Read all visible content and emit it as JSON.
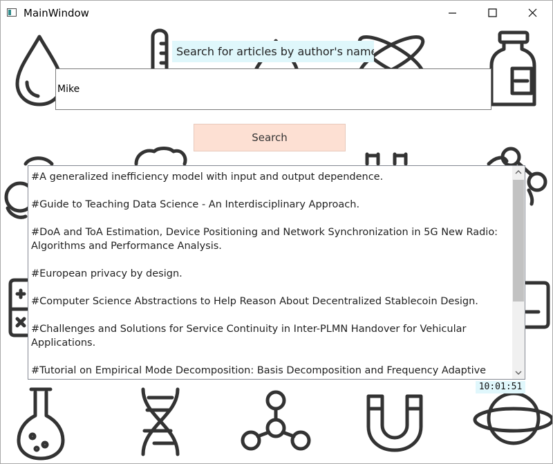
{
  "window": {
    "title": "MainWindow",
    "controls": [
      "minimize-icon",
      "maximize-icon",
      "close-icon"
    ]
  },
  "search": {
    "label": "Search for articles by author's name!",
    "input_value": "Mike",
    "button_label": "Search"
  },
  "results": [
    "#A generalized inefficiency model with input and output dependence.",
    "#Guide to Teaching Data Science - An Interdisciplinary Approach.",
    "#DoA and ToA Estimation, Device Positioning and Network Synchronization in 5G New Radio: Algorithms and Performance Analysis.",
    "#European privacy by design.",
    "#Computer Science Abstractions to Help Reason About Decentralized Stablecoin Design.",
    "#Challenges and Solutions for Service Continuity in Inter-PLMN Handover for Vehicular Applications.",
    "#Tutorial on Empirical Mode Decomposition: Basis Decomposition and Frequency Adaptive Graduation in Non-Stationary Time Series."
  ],
  "clock": "10:01:51",
  "background_icons": [
    "water-drop-icon",
    "thermometer-icon",
    "flame-icon",
    "atom-icon",
    "medicine-bottle-icon",
    "biohazard-icon",
    "brain-icon",
    "lab-equipment-icon",
    "molecule-icon",
    "calculator-icon",
    "clipboard-icon",
    "flask-icon",
    "dna-icon",
    "network-molecule-icon",
    "magnet-icon",
    "planet-icon"
  ],
  "colors": {
    "label_bg": "#dff7fb",
    "button_bg": "#fde0d3",
    "clock_bg": "#e0f7fc",
    "icon_stroke": "#333333"
  }
}
